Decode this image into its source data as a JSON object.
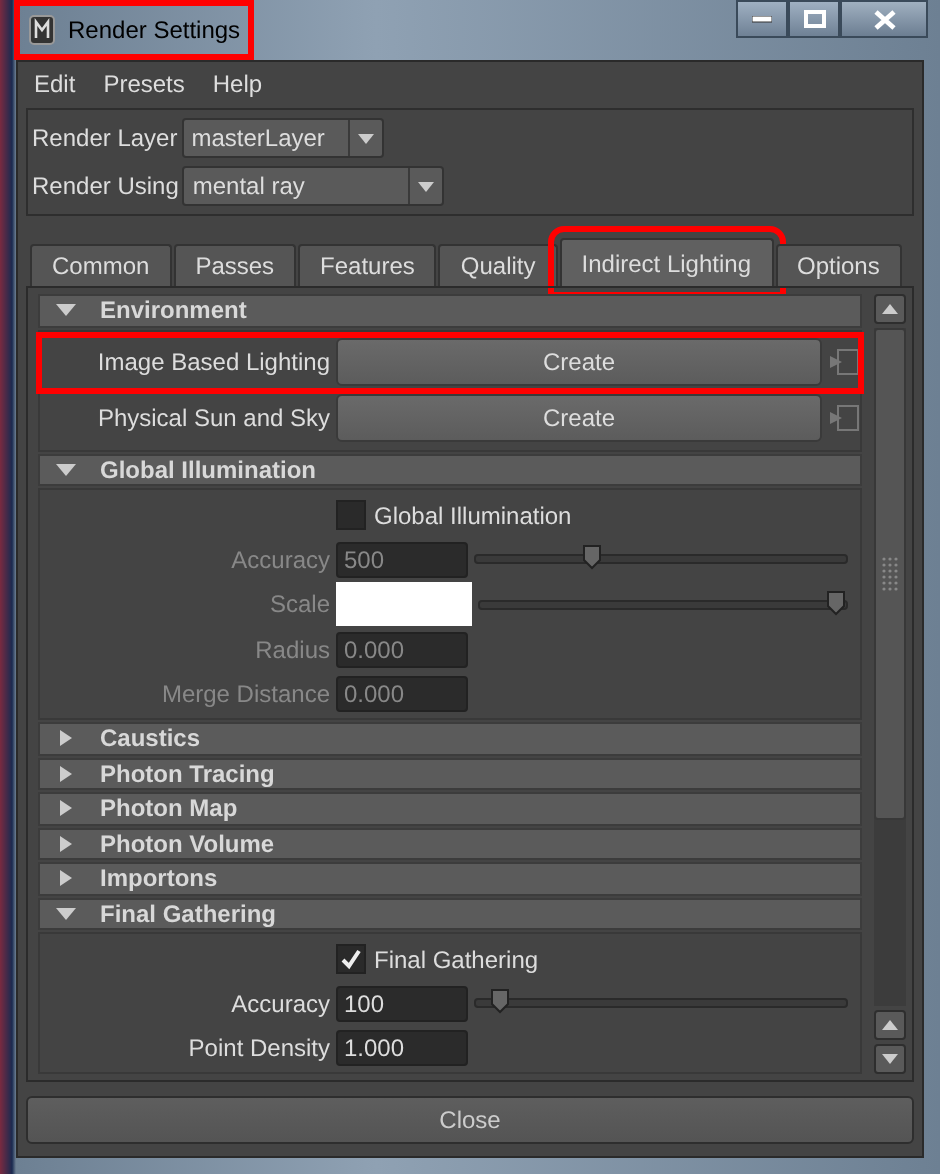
{
  "window": {
    "title": "Render Settings",
    "highlighted": true
  },
  "menu": [
    "Edit",
    "Presets",
    "Help"
  ],
  "render_layer": {
    "label": "Render Layer",
    "value": "masterLayer"
  },
  "render_using": {
    "label": "Render Using",
    "value": "mental ray"
  },
  "tabs": [
    {
      "label": "Common",
      "selected": false,
      "highlighted": false
    },
    {
      "label": "Passes",
      "selected": false,
      "highlighted": false
    },
    {
      "label": "Features",
      "selected": false,
      "highlighted": false
    },
    {
      "label": "Quality",
      "selected": false,
      "highlighted": false
    },
    {
      "label": "Indirect Lighting",
      "selected": true,
      "highlighted": true
    },
    {
      "label": "Options",
      "selected": false,
      "highlighted": false
    }
  ],
  "sections": [
    {
      "title": "Environment",
      "expanded": true,
      "rows": [
        {
          "kind": "button",
          "label": "Image Based Lighting",
          "button": "Create",
          "highlighted": true
        },
        {
          "kind": "button",
          "label": "Physical Sun and Sky",
          "button": "Create",
          "highlighted": false
        }
      ]
    },
    {
      "title": "Global Illumination",
      "expanded": true,
      "rows": [
        {
          "kind": "checkbox",
          "label": "Global Illumination",
          "checked": false
        },
        {
          "kind": "slider",
          "label": "Accuracy",
          "value": "500",
          "level": 0.3,
          "disabled": true
        },
        {
          "kind": "color",
          "label": "Scale",
          "level": 1.0,
          "disabled": true
        },
        {
          "kind": "field",
          "label": "Radius",
          "value": "0.000",
          "disabled": true
        },
        {
          "kind": "field",
          "label": "Merge Distance",
          "value": "0.000",
          "disabled": true
        }
      ]
    },
    {
      "title": "Caustics",
      "expanded": false
    },
    {
      "title": "Photon Tracing",
      "expanded": false
    },
    {
      "title": "Photon Map",
      "expanded": false
    },
    {
      "title": "Photon Volume",
      "expanded": false
    },
    {
      "title": "Importons",
      "expanded": false
    },
    {
      "title": "Final Gathering",
      "expanded": true,
      "rows": [
        {
          "kind": "checkbox",
          "label": "Final Gathering",
          "checked": true
        },
        {
          "kind": "slider",
          "label": "Accuracy",
          "value": "100",
          "level": 0.04,
          "disabled": false
        },
        {
          "kind": "field",
          "label": "Point Density",
          "value": "1.000",
          "disabled": false
        }
      ]
    }
  ],
  "close_button": "Close"
}
